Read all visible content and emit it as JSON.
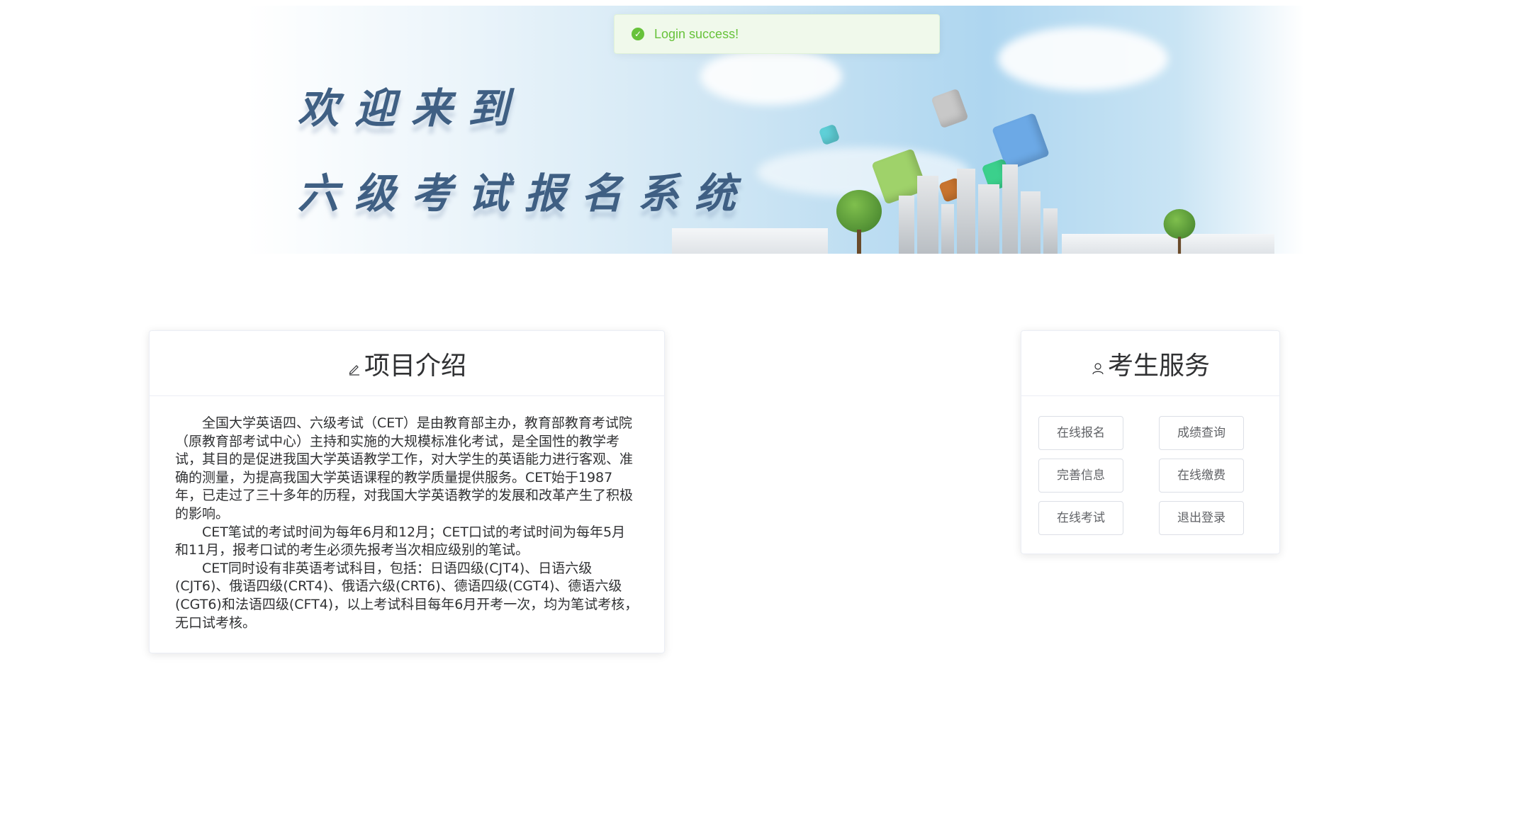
{
  "banner": {
    "line1": "欢迎来到",
    "line2": "六级考试报名系统"
  },
  "toast": {
    "icon": "check-circle-icon",
    "message": "Login success!",
    "color": "#67c23a"
  },
  "intro": {
    "icon": "edit-icon",
    "title": "项目介绍",
    "paragraphs": [
      "全国大学英语四、六级考试（CET）是由教育部主办，教育部教育考试院（原教育部考试中心）主持和实施的大规模标准化考试，是全国性的教学考试，其目的是促进我国大学英语教学工作，对大学生的英语能力进行客观、准确的测量，为提高我国大学英语课程的教学质量提供服务。CET始于1987年，已走过了三十多年的历程，对我国大学英语教学的发展和改革产生了积极的影响。",
      "CET笔试的考试时间为每年6月和12月；CET口试的考试时间为每年5月和11月，报考口试的考生必须先报考当次相应级别的笔试。",
      "CET同时设有非英语考试科目，包括：日语四级(CJT4)、日语六级(CJT6)、俄语四级(CRT4)、俄语六级(CRT6)、德语四级(CGT4)、德语六级(CGT6)和法语四级(CFT4)，以上考试科目每年6月开考一次，均为笔试考核，无口试考核。"
    ]
  },
  "service": {
    "icon": "user-icon",
    "title": "考生服务",
    "buttons": [
      "在线报名",
      "成绩查询",
      "完善信息",
      "在线缴费",
      "在线考试",
      "退出登录"
    ]
  }
}
